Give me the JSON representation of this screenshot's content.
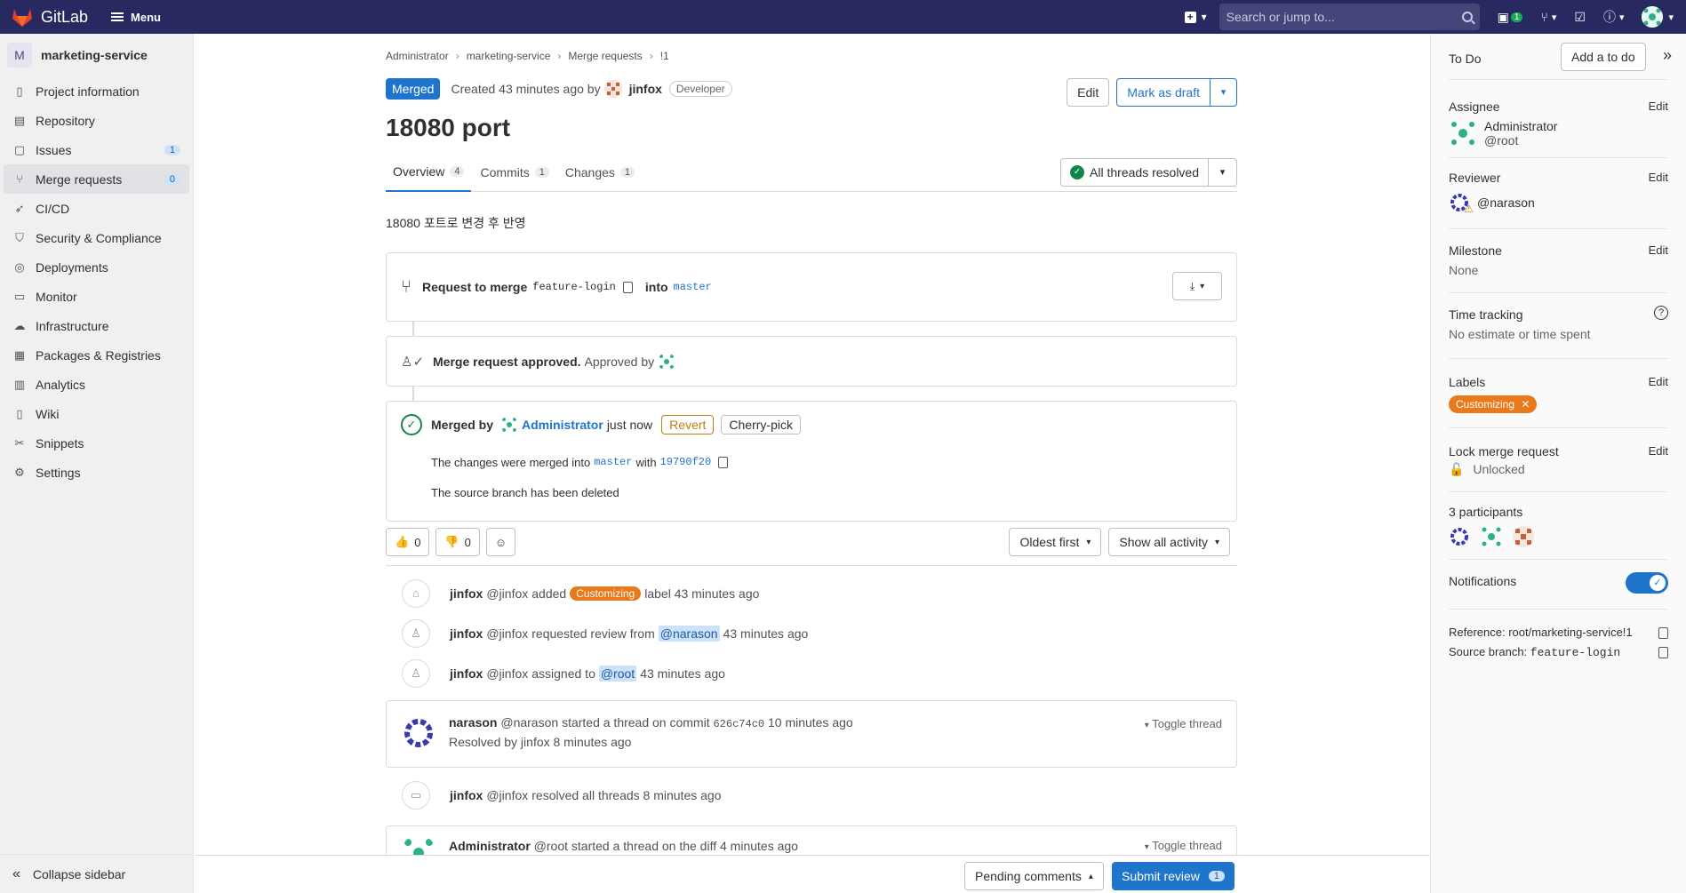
{
  "topbar": {
    "app_name": "GitLab",
    "menu_label": "Menu",
    "search_placeholder": "Search or jump to...",
    "mr_badge": "1"
  },
  "sidebar": {
    "project_initial": "M",
    "project_name": "marketing-service",
    "items": [
      {
        "label": "Project information",
        "icon": "info-icon"
      },
      {
        "label": "Repository",
        "icon": "book-icon"
      },
      {
        "label": "Issues",
        "icon": "issues-icon",
        "count": "1"
      },
      {
        "label": "Merge requests",
        "icon": "merge-request-icon",
        "count": "0"
      },
      {
        "label": "CI/CD",
        "icon": "rocket-icon"
      },
      {
        "label": "Security & Compliance",
        "icon": "shield-icon"
      },
      {
        "label": "Deployments",
        "icon": "deployments-icon"
      },
      {
        "label": "Monitor",
        "icon": "monitor-icon"
      },
      {
        "label": "Infrastructure",
        "icon": "cloud-icon"
      },
      {
        "label": "Packages & Registries",
        "icon": "package-icon"
      },
      {
        "label": "Analytics",
        "icon": "chart-icon"
      },
      {
        "label": "Wiki",
        "icon": "wiki-icon"
      },
      {
        "label": "Snippets",
        "icon": "scissors-icon"
      },
      {
        "label": "Settings",
        "icon": "gear-icon"
      }
    ],
    "collapse_label": "Collapse sidebar"
  },
  "breadcrumb": [
    "Administrator",
    "marketing-service",
    "Merge requests",
    "!1"
  ],
  "mr": {
    "status": "Merged",
    "created_prefix": "Created 43 minutes ago by",
    "author": "jinfox",
    "author_role": "Developer",
    "edit_label": "Edit",
    "draft_label": "Mark as draft",
    "title": "18080 port",
    "description": "18080 포트로 변경 후 반영",
    "tabs": [
      {
        "label": "Overview",
        "count": "4"
      },
      {
        "label": "Commits",
        "count": "1"
      },
      {
        "label": "Changes",
        "count": "1"
      }
    ],
    "threads_label": "All threads resolved"
  },
  "widget": {
    "request_prefix": "Request to merge",
    "source_branch": "feature-login",
    "into": "into",
    "target_branch": "master",
    "approved_text": "Merge request approved.",
    "approved_by": "Approved by",
    "merged_by": "Merged by",
    "merged_user": "Administrator",
    "merged_time": "just now",
    "revert_label": "Revert",
    "cherry_label": "Cherry-pick",
    "merged_into_prefix": "The changes were merged into",
    "merged_into_branch": "master",
    "with_word": "with",
    "commit_sha": "19790f20",
    "deleted_text": "The source branch has been deleted"
  },
  "reactions": {
    "thumbsup_count": "0",
    "thumbsdown_count": "0",
    "sort_label": "Oldest first",
    "filter_label": "Show all activity"
  },
  "activity": {
    "note1": {
      "user": "jinfox",
      "handle": "@jinfox",
      "pre": "added",
      "label": "Customizing",
      "post": "label 43 minutes ago"
    },
    "note2": {
      "user": "jinfox",
      "handle": "@jinfox",
      "pre": "requested review from",
      "mention": "@narason",
      "post": "43 minutes ago"
    },
    "note3": {
      "user": "jinfox",
      "handle": "@jinfox",
      "pre": "assigned to",
      "mention": "@root",
      "post": "43 minutes ago"
    },
    "thread1": {
      "user": "narason",
      "handle": "@narason",
      "text": "started a thread on commit",
      "commit": "626c74c0",
      "time": "10 minutes ago",
      "resolved": "Resolved by jinfox 8 minutes ago",
      "toggle": "Toggle thread"
    },
    "note4": {
      "user": "jinfox",
      "handle": "@jinfox",
      "text": "resolved all threads 8 minutes ago"
    },
    "thread2": {
      "user": "Administrator",
      "handle": "@root",
      "text": "started a thread on the diff 4 minutes ago",
      "toggle": "Toggle thread"
    }
  },
  "review_bar": {
    "pending_label": "Pending comments",
    "submit_label": "Submit review",
    "submit_count": "1"
  },
  "right_sidebar": {
    "todo_label": "To Do",
    "add_todo": "Add a to do",
    "assignee_label": "Assignee",
    "assignee_name": "Administrator",
    "assignee_handle": "@root",
    "reviewer_label": "Reviewer",
    "reviewer_handle": "@narason",
    "milestone_label": "Milestone",
    "milestone_value": "None",
    "time_label": "Time tracking",
    "time_value": "No estimate or time spent",
    "labels_label": "Labels",
    "label_value": "Customizing",
    "lock_label": "Lock merge request",
    "lock_value": "Unlocked",
    "participants_label": "3 participants",
    "notifications_label": "Notifications",
    "notifications_on": true,
    "reference": "Reference: root/marketing-service!1",
    "source_prefix": "Source branch:",
    "source_branch": "feature-login",
    "edit": "Edit"
  },
  "colors": {
    "navbar": "#292961",
    "brand_blue": "#1f75cb",
    "merged_badge": "#1f75cb",
    "label_orange": "#e9791a",
    "revert": "#c17d10",
    "success": "#108548"
  }
}
